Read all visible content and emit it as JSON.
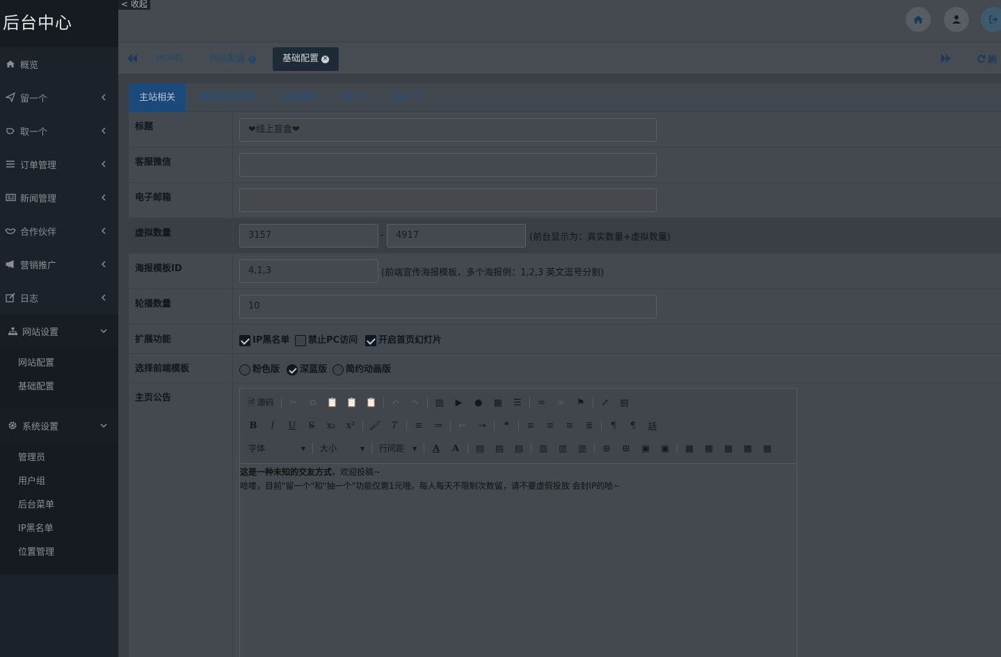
{
  "sidebar": {
    "brand": "后台中心",
    "items": [
      {
        "label": "概览",
        "icon": "home-icon"
      },
      {
        "label": "留一个",
        "icon": "paper-plane-icon"
      },
      {
        "label": "取一个",
        "icon": "hand-icon"
      },
      {
        "label": "订单管理",
        "icon": "list-icon"
      },
      {
        "label": "新闻管理",
        "icon": "newspaper-icon"
      },
      {
        "label": "合作伙伴",
        "icon": "handshake-icon"
      },
      {
        "label": "营销推广",
        "icon": "bullhorn-icon"
      },
      {
        "label": "日志",
        "icon": "edit-icon"
      },
      {
        "label": "网站设置",
        "icon": "sitemap-icon"
      },
      {
        "label": "系统设置",
        "icon": "gear-icon"
      }
    ],
    "site_settings_sub": [
      "网站配置",
      "基础配置"
    ],
    "system_settings_sub": [
      "管理员",
      "用户组",
      "后台菜单",
      "IP黑名单",
      "位置管理"
    ]
  },
  "collapse": "< 收起",
  "tabs": {
    "home": "HOME",
    "tab1": "网站配置",
    "tab2": "基础配置",
    "refresh": "刷"
  },
  "subtabs": [
    "主站相关",
    "微信支付相关",
    "分销相关",
    "留一个",
    "抽一个"
  ],
  "form": {
    "title_label": "标题",
    "title_value": "❤线上盲盒❤",
    "wechat_label": "客服微信",
    "wechat_value": "",
    "email_label": "电子邮箱",
    "email_value": "",
    "virtual_label": "虚拟数量",
    "virtual_min": "3157",
    "virtual_sep": "-",
    "virtual_max": "4917",
    "virtual_hint": "(前台显示为：真实数量+虚拟数量)",
    "poster_label": "海报模板ID",
    "poster_value": "4,1,3",
    "poster_hint": "(前端宣传海报模板，多个海报例：1,2,3 英文逗号分割)",
    "carousel_label": "轮播数量",
    "carousel_value": "10",
    "ext_label": "扩展功能",
    "ext_options": [
      {
        "label": "IP黑名单",
        "checked": true
      },
      {
        "label": "禁止PC访问",
        "checked": false
      },
      {
        "label": "开启首页幻灯片",
        "checked": true
      }
    ],
    "theme_label": "选择前端模板",
    "theme_options": [
      {
        "label": "粉色版",
        "selected": false
      },
      {
        "label": "深蓝版",
        "selected": true
      },
      {
        "label": "简约动画版",
        "selected": false
      }
    ],
    "notice_label": "主页公告"
  },
  "editor": {
    "source_label": "源码",
    "font_label": "字体",
    "size_label": "大小",
    "lineheight_label": "行间距",
    "line1_bold": "这是一种未知的交友方式",
    "line1_rest": "，欢迎投稿~",
    "line2": "哈喽，目前\"留一个\"和\"抽一个\"功能仅需1元哦，每人每天不限制次数留，请不要虚假投放 会封IP的哈~"
  },
  "colors": {
    "accent": "#1b4a7a",
    "sidebar": "#1b2229"
  }
}
